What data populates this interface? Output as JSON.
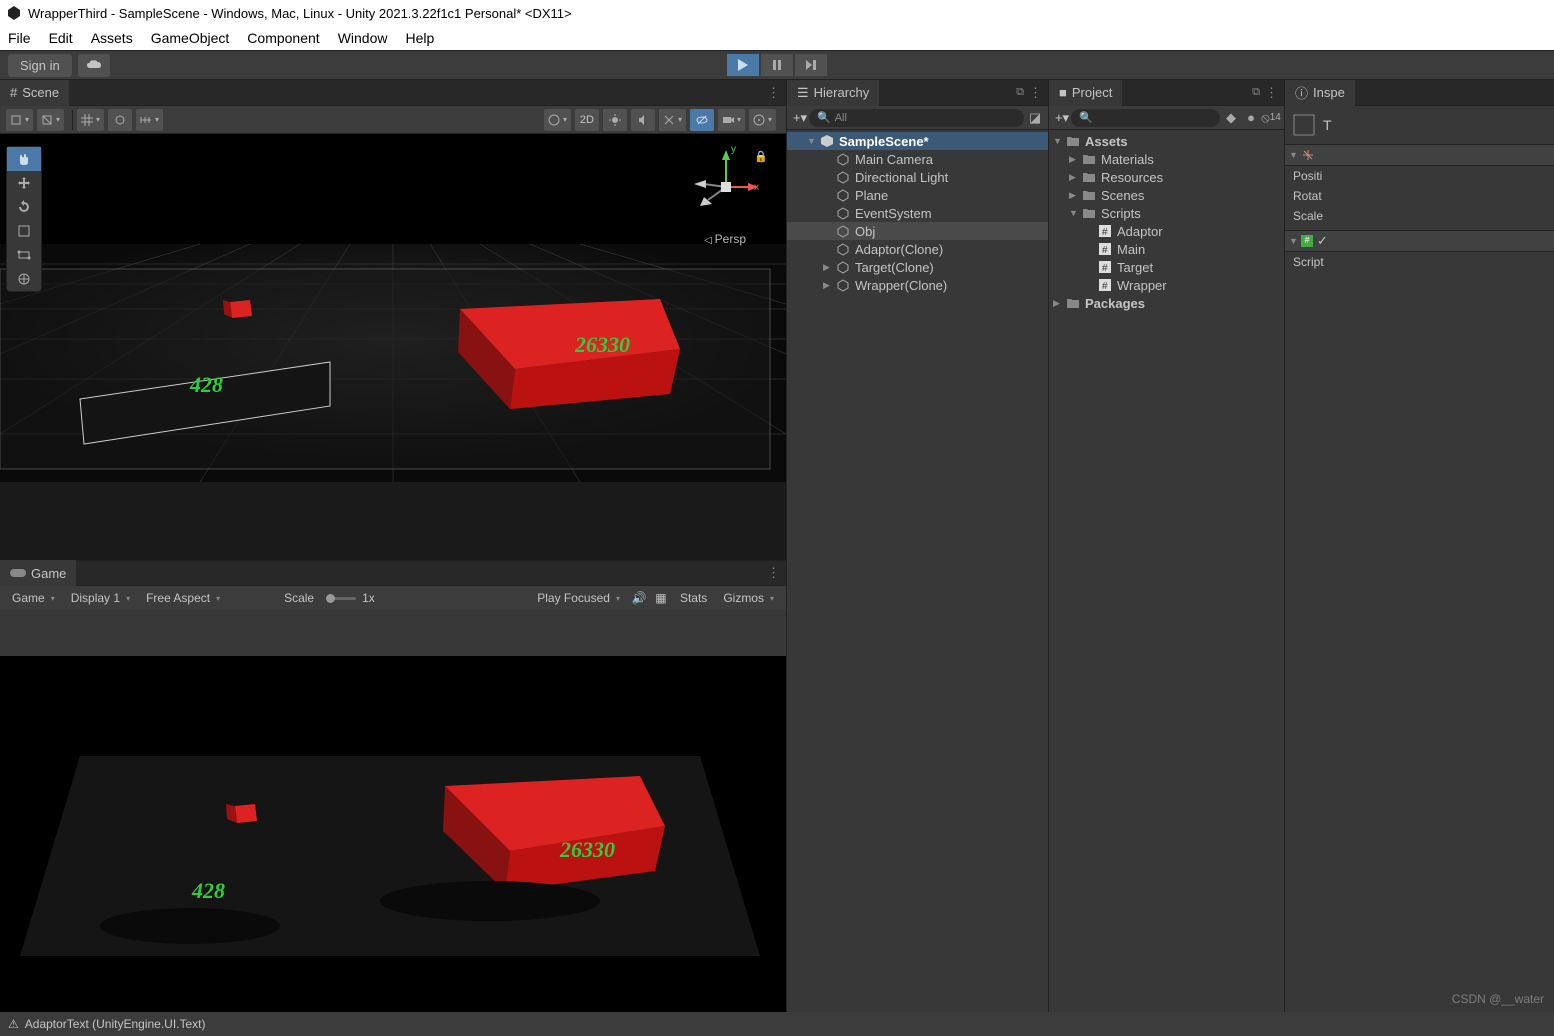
{
  "window_title": "WrapperThird - SampleScene - Windows, Mac, Linux - Unity 2021.3.22f1c1 Personal* <DX11>",
  "menubar": [
    "File",
    "Edit",
    "Assets",
    "GameObject",
    "Component",
    "Window",
    "Help"
  ],
  "toolbar": {
    "signin": "Sign in"
  },
  "scene": {
    "tab": "Scene",
    "toolbar": {
      "btn_2d": "2D"
    },
    "persp": "Persp",
    "axes": {
      "x": "x",
      "y": "y"
    },
    "values": {
      "left": "428",
      "right": "26330"
    }
  },
  "game": {
    "tab": "Game",
    "dropdown1": "Game",
    "display": "Display 1",
    "aspect": "Free Aspect",
    "scale_label": "Scale",
    "scale_value": "1x",
    "play_on": "Play Focused",
    "stats": "Stats",
    "gizmos": "Gizmos",
    "values": {
      "left": "428",
      "right": "26330"
    }
  },
  "hierarchy": {
    "tab": "Hierarchy",
    "search_placeholder": "All",
    "items": [
      {
        "label": "SampleScene*",
        "indent": 1,
        "arrow": "▼",
        "icon": "unity",
        "bold": true
      },
      {
        "label": "Main Camera",
        "indent": 2,
        "icon": "cube"
      },
      {
        "label": "Directional Light",
        "indent": 2,
        "icon": "cube"
      },
      {
        "label": "Plane",
        "indent": 2,
        "icon": "cube"
      },
      {
        "label": "EventSystem",
        "indent": 2,
        "icon": "cube"
      },
      {
        "label": "Obj",
        "indent": 2,
        "icon": "cube",
        "sel": true
      },
      {
        "label": "Adaptor(Clone)",
        "indent": 2,
        "icon": "cube"
      },
      {
        "label": "Target(Clone)",
        "indent": 2,
        "arrow": "▶",
        "icon": "cube"
      },
      {
        "label": "Wrapper(Clone)",
        "indent": 2,
        "arrow": "▶",
        "icon": "cube"
      }
    ]
  },
  "project": {
    "tab": "Project",
    "badge": "14",
    "items": [
      {
        "label": "Assets",
        "indent": 0,
        "arrow": "▼",
        "icon": "folder",
        "bold": true
      },
      {
        "label": "Materials",
        "indent": 1,
        "arrow": "▶",
        "icon": "folder"
      },
      {
        "label": "Resources",
        "indent": 1,
        "arrow": "▶",
        "icon": "folder"
      },
      {
        "label": "Scenes",
        "indent": 1,
        "arrow": "▶",
        "icon": "folder"
      },
      {
        "label": "Scripts",
        "indent": 1,
        "arrow": "▼",
        "icon": "folder"
      },
      {
        "label": "Adaptor",
        "indent": 2,
        "icon": "cs"
      },
      {
        "label": "Main",
        "indent": 2,
        "icon": "cs"
      },
      {
        "label": "Target",
        "indent": 2,
        "icon": "cs"
      },
      {
        "label": "Wrapper",
        "indent": 2,
        "icon": "cs"
      },
      {
        "label": "Packages",
        "indent": 0,
        "arrow": "▶",
        "icon": "folder",
        "bold": true
      }
    ]
  },
  "inspector": {
    "tab": "Inspe",
    "header_letter": "T",
    "rows": [
      "Positi",
      "Rotat",
      "Scale"
    ],
    "script_label": "Script"
  },
  "status": "AdaptorText (UnityEngine.UI.Text)",
  "watermark": "CSDN @__water"
}
